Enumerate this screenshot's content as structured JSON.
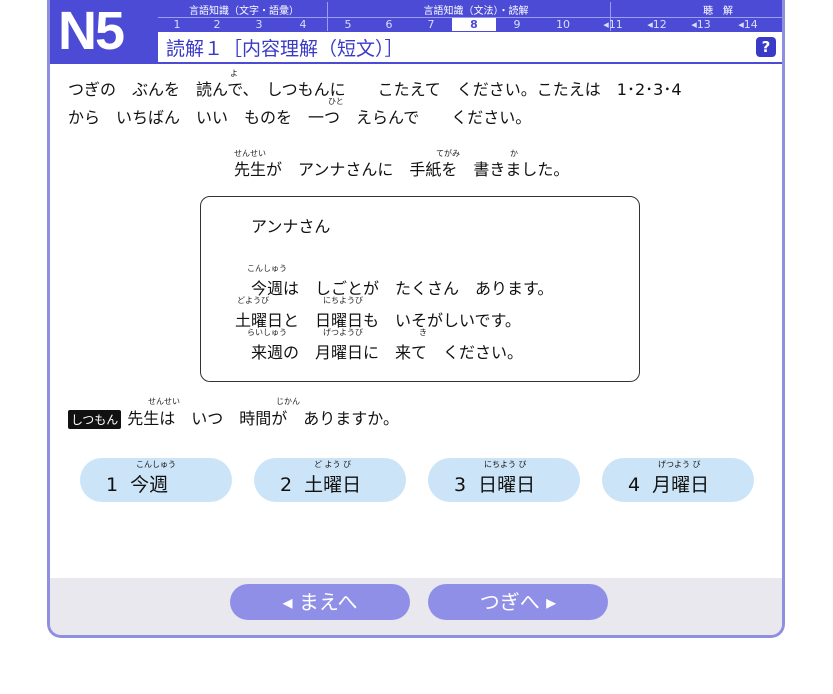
{
  "header": {
    "logo": "N5",
    "categories": [
      "言語知識（文字・語彙）",
      "言語知識（文法）・読解",
      "聴　解"
    ],
    "numbers": [
      "1",
      "2",
      "3",
      "4",
      "5",
      "6",
      "7",
      "8",
      "9",
      "10",
      "◂11",
      "◂12",
      "◂13",
      "◂14"
    ],
    "active_number": "8",
    "title": "読解１［内容理解（短文）］",
    "help_label": "?"
  },
  "instruction": {
    "line1": "つぎの　ぶんを　読んで、　しつもんに　　こたえて　ください。こたえは　1･2･3･4",
    "line2": "から　いちばん　いい　ものを　一つ　えらんで　　ください。",
    "ruby_yo": "よ",
    "ruby_hito": "ひと"
  },
  "lead": {
    "text": "先生が　アンナさんに　手紙を　書きました。",
    "ruby_sensei": "せんせい",
    "ruby_tegami": "てがみ",
    "ruby_ka": "か"
  },
  "letter": {
    "greeting": "アンナさん",
    "line1": "今週は　しごとが　たくさん　あります。",
    "line2": "土曜日と　日曜日も　いそがしいです。",
    "line3": "来週の　月曜日に　来て　ください。",
    "ruby_konshuu": "こんしゅう",
    "ruby_doyoubi": "どようび",
    "ruby_nichiyoubi": "にちようび",
    "ruby_raishuu": "らいしゅう",
    "ruby_getsuyoubi": "げつようび",
    "ruby_ki": "き"
  },
  "question": {
    "tag": "しつもん",
    "text": "先生は　いつ　時間が　ありますか。",
    "ruby_sensei": "せんせい",
    "ruby_jikan": "じかん"
  },
  "choices": [
    {
      "label": "1  今週",
      "ruby": "こんしゅう"
    },
    {
      "label": "2  土曜日",
      "ruby": "ど よう び"
    },
    {
      "label": "3  日曜日",
      "ruby": "にちよう び"
    },
    {
      "label": "4  月曜日",
      "ruby": "げつよう び"
    }
  ],
  "nav": {
    "prev_label": "◂ まえへ",
    "next_label": "つぎへ ▸"
  },
  "colors": {
    "accent": "#4b4bd6",
    "choice_bg": "#cce4f7",
    "nav_button": "#8f8fe8"
  }
}
